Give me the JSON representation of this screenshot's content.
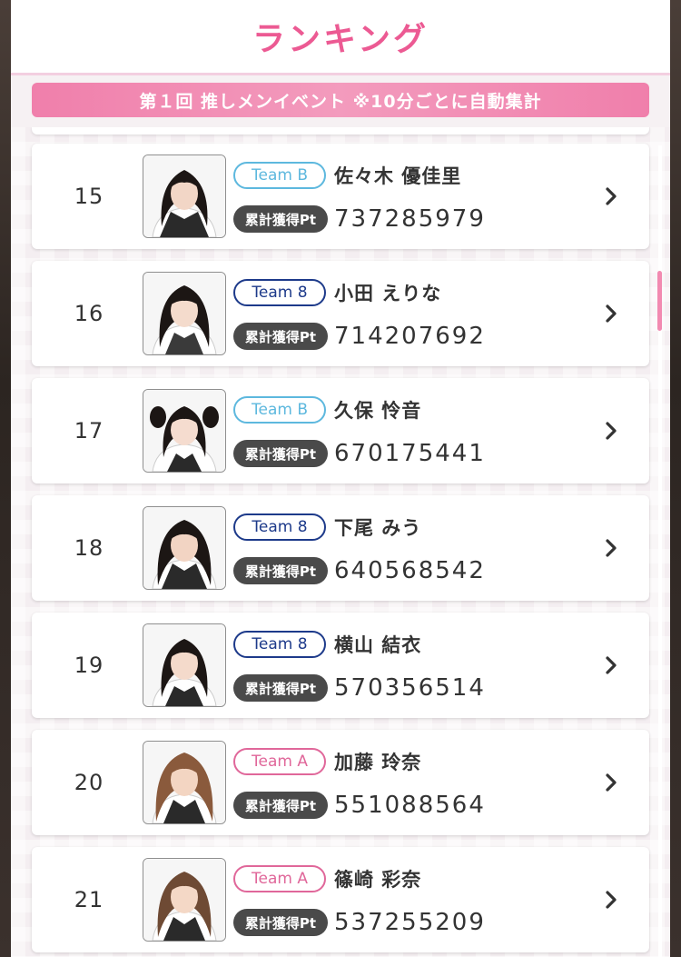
{
  "header": {
    "title": "ランキング"
  },
  "event_banner": {
    "text": "第１回 推しメンイベント ※10分ごとに自動集計"
  },
  "colors": {
    "accent_pink": "#ec5a93",
    "team_b": "#5db8de",
    "team_8": "#1d3a8a",
    "team_a": "#e0679a"
  },
  "rankings": [
    {
      "rank": "15",
      "team": "Team B",
      "team_key": "b",
      "name": "佐々木 優佳里",
      "pt_label": "累計獲得Pt",
      "points": "737285979",
      "hair": "#1c1614"
    },
    {
      "rank": "16",
      "team": "Team 8",
      "team_key": "8",
      "name": "小田 えりな",
      "pt_label": "累計獲得Pt",
      "points": "714207692",
      "hair": "#1c1614"
    },
    {
      "rank": "17",
      "team": "Team B",
      "team_key": "b",
      "name": "久保 怜音",
      "pt_label": "累計獲得Pt",
      "points": "670175441",
      "hair": "#1c1614"
    },
    {
      "rank": "18",
      "team": "Team 8",
      "team_key": "8",
      "name": "下尾 みう",
      "pt_label": "累計獲得Pt",
      "points": "640568542",
      "hair": "#1c1614"
    },
    {
      "rank": "19",
      "team": "Team 8",
      "team_key": "8",
      "name": "横山 結衣",
      "pt_label": "累計獲得Pt",
      "points": "570356514",
      "hair": "#1c1614"
    },
    {
      "rank": "20",
      "team": "Team A",
      "team_key": "a",
      "name": "加藤 玲奈",
      "pt_label": "累計獲得Pt",
      "points": "551088564",
      "hair": "#8a5a3c"
    },
    {
      "rank": "21",
      "team": "Team A",
      "team_key": "a",
      "name": "篠崎 彩奈",
      "pt_label": "累計獲得Pt",
      "points": "537255209",
      "hair": "#6e4a34"
    }
  ]
}
